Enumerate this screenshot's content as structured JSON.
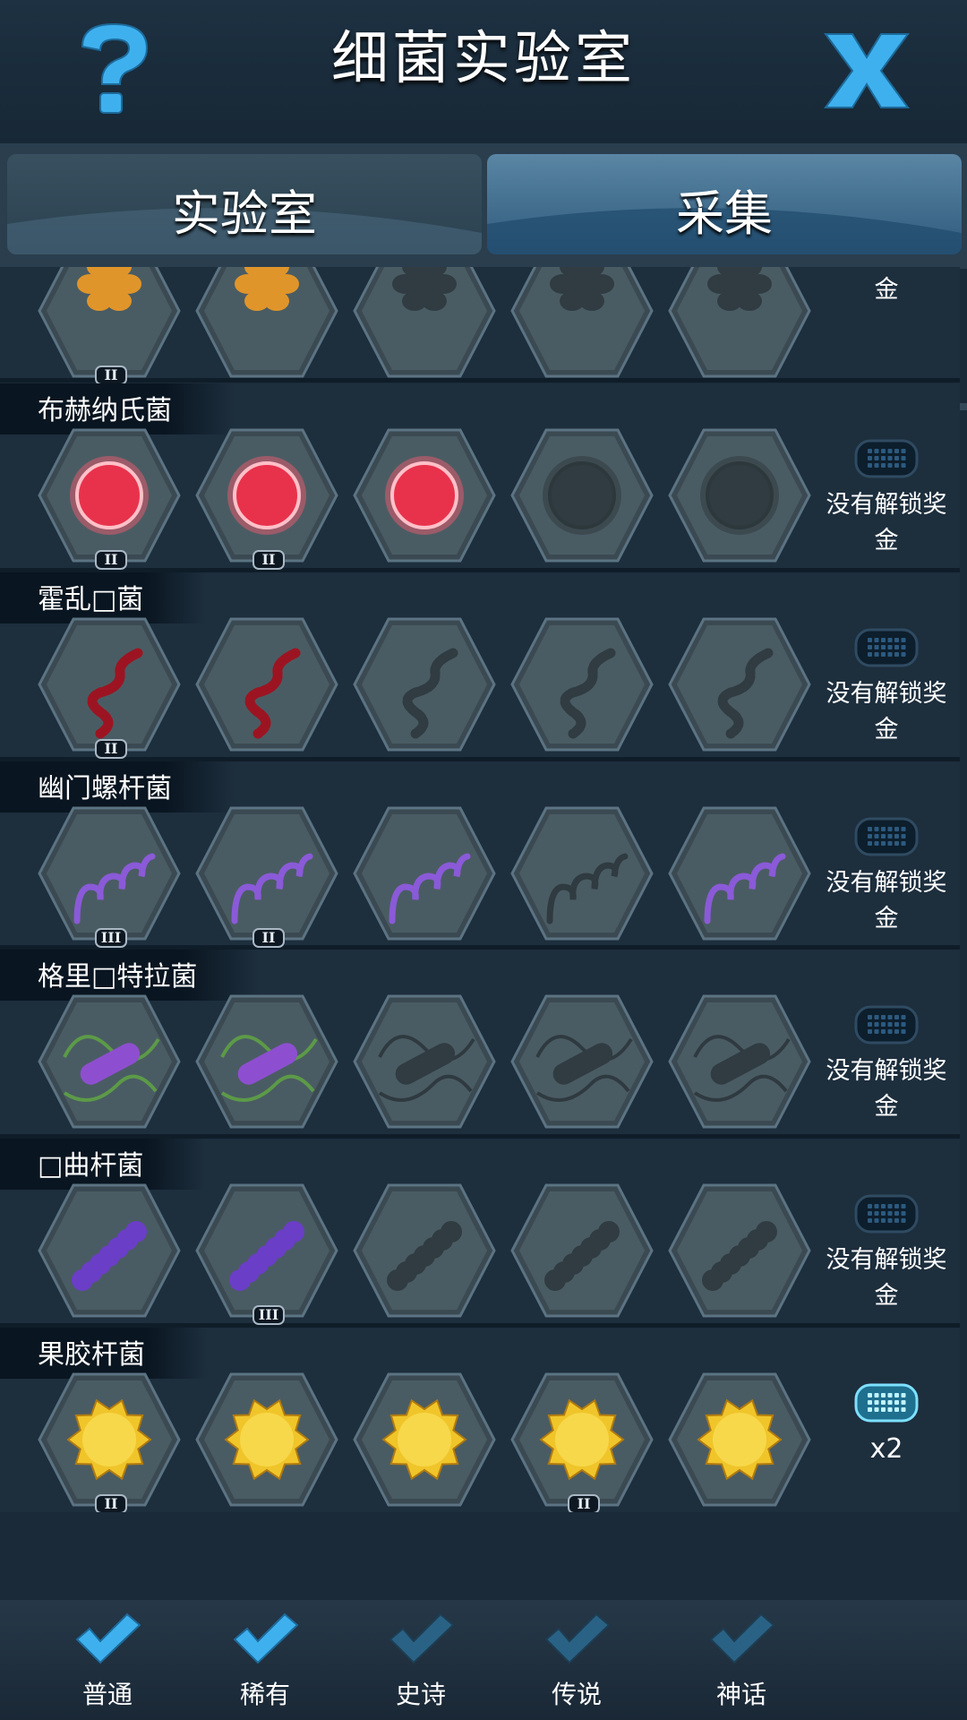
{
  "header": {
    "title": "细菌实验室",
    "help_icon": "question-icon",
    "close_icon": "close-x-icon"
  },
  "tabs": [
    {
      "label": "实验室",
      "active": true
    },
    {
      "label": "采集",
      "active": false
    }
  ],
  "tab_scroll_progress": 0.42,
  "rows": [
    {
      "name": "",
      "reward": "没有解锁奖金",
      "unlocked": [
        true,
        true,
        false,
        false,
        false
      ],
      "badges": [
        "II",
        "",
        "",
        "",
        ""
      ],
      "shape": "blob",
      "color": "#e0952a"
    },
    {
      "name": "布赫纳氏菌",
      "reward": "没有解锁奖金",
      "unlocked": [
        true,
        true,
        true,
        false,
        false
      ],
      "badges": [
        "II",
        "II",
        "",
        "",
        ""
      ],
      "shape": "cell",
      "color": "#e8324c"
    },
    {
      "name": "霍乱□菌",
      "reward": "没有解锁奖金",
      "unlocked": [
        true,
        true,
        false,
        false,
        false
      ],
      "badges": [
        "II",
        "",
        "",
        "",
        ""
      ],
      "shape": "chain",
      "color": "#9c1422"
    },
    {
      "name": "幽门螺杆菌",
      "reward": "没有解锁奖金",
      "unlocked": [
        true,
        true,
        true,
        false,
        true
      ],
      "badges": [
        "III",
        "II",
        "",
        "",
        ""
      ],
      "shape": "spiral",
      "color": "#8a5ad8"
    },
    {
      "name": "格里□特拉菌",
      "reward": "没有解锁奖金",
      "unlocked": [
        true,
        true,
        false,
        false,
        false
      ],
      "badges": [
        "",
        "",
        "",
        "",
        ""
      ],
      "shape": "rod",
      "color": "#8d4fcf"
    },
    {
      "name": "□曲杆菌",
      "reward": "没有解锁奖金",
      "unlocked": [
        true,
        true,
        false,
        false,
        false
      ],
      "badges": [
        "",
        "III",
        "",
        "",
        ""
      ],
      "shape": "cluster",
      "color": "#6a3ec6"
    },
    {
      "name": "果胶杆菌",
      "reward": "x2",
      "reward_active": true,
      "unlocked": [
        true,
        true,
        true,
        true,
        true
      ],
      "badges": [
        "II",
        "",
        "",
        "II",
        ""
      ],
      "shape": "star",
      "color": "#f0c52a"
    }
  ],
  "filters": [
    {
      "label": "普通",
      "checked": true
    },
    {
      "label": "稀有",
      "checked": true
    },
    {
      "label": "史诗",
      "checked": false
    },
    {
      "label": "传说",
      "checked": false
    },
    {
      "label": "神话",
      "checked": false
    }
  ],
  "colors": {
    "accent": "#3fb0ee",
    "check_dim": "#2a6285",
    "panel": "#1d2e3d"
  }
}
